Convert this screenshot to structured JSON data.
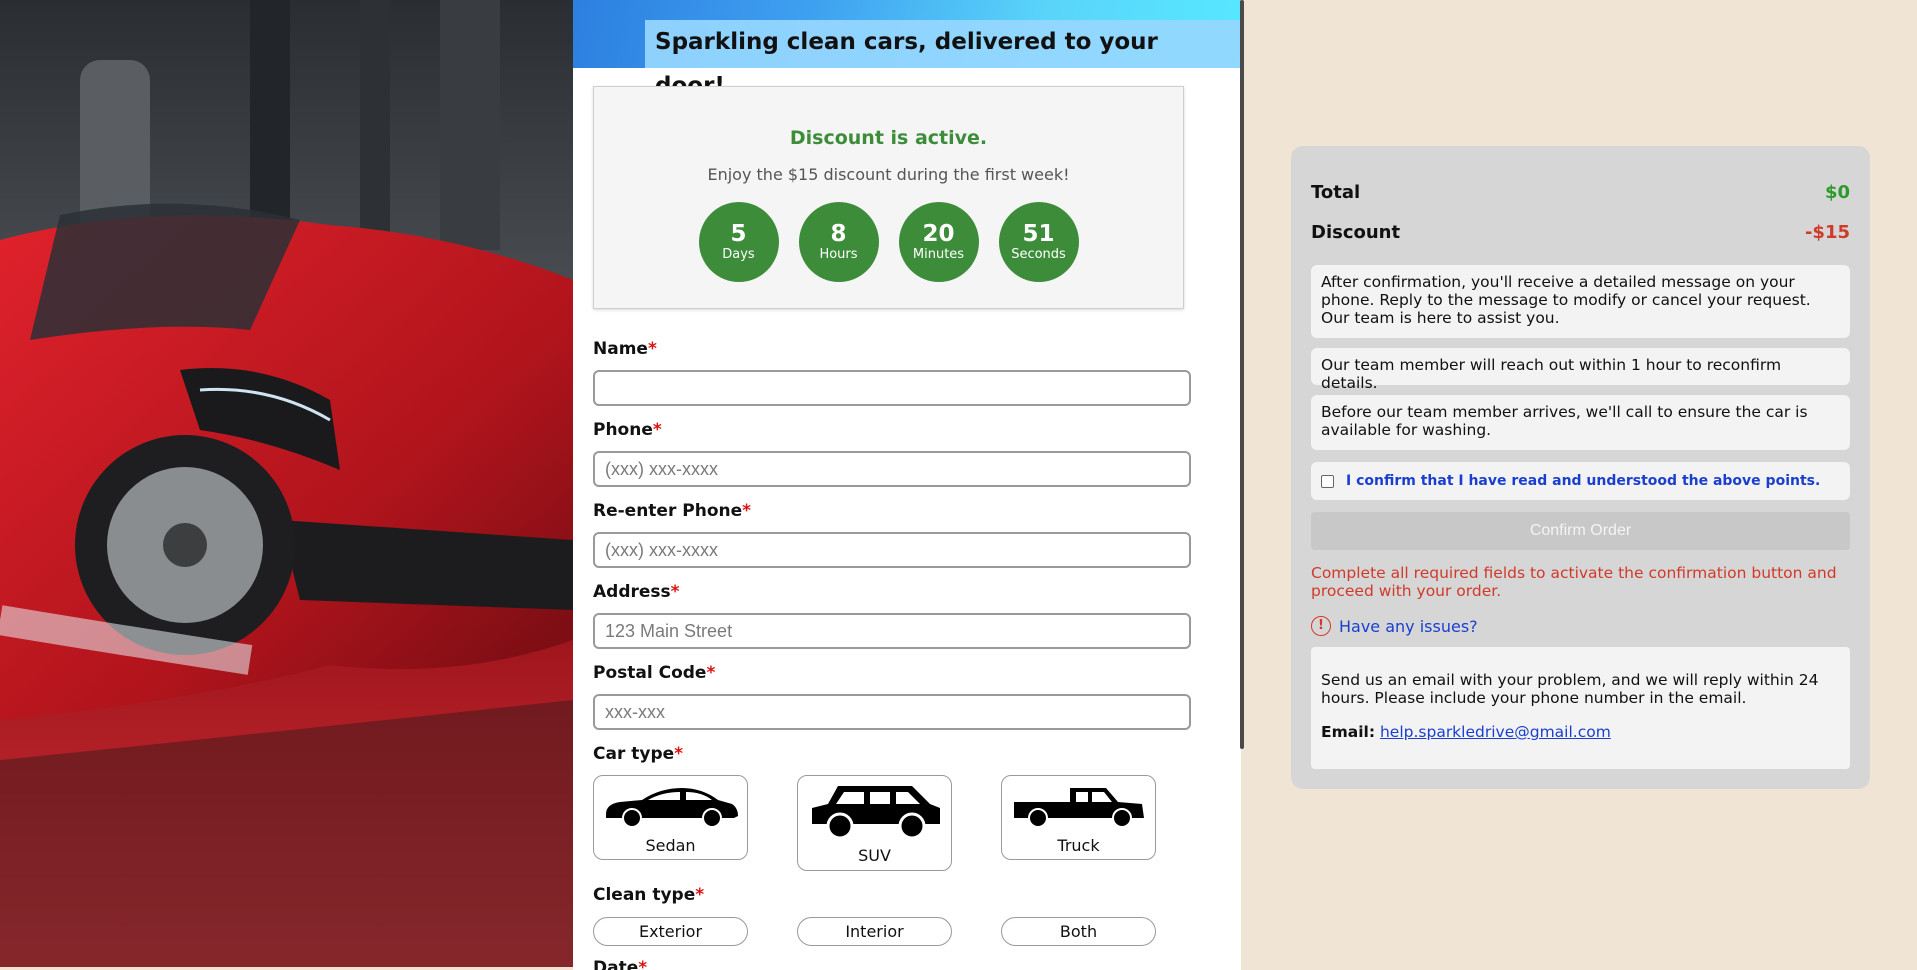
{
  "banner": {
    "title": "Sparkling clean cars, delivered to your door!"
  },
  "discount": {
    "title": "Discount is active.",
    "subtitle": "Enjoy the $15 discount during the first week!",
    "timer": [
      {
        "value": "5",
        "unit": "Days"
      },
      {
        "value": "8",
        "unit": "Hours"
      },
      {
        "value": "20",
        "unit": "Minutes"
      },
      {
        "value": "51",
        "unit": "Seconds"
      }
    ]
  },
  "form": {
    "required_mark": "*",
    "name": {
      "label": "Name",
      "placeholder": ""
    },
    "phone": {
      "label": "Phone",
      "placeholder": "(xxx) xxx-xxxx"
    },
    "phone_confirm": {
      "label": "Re-enter Phone",
      "placeholder": "(xxx) xxx-xxxx"
    },
    "address": {
      "label": "Address",
      "placeholder": "123 Main Street"
    },
    "postal": {
      "label": "Postal Code",
      "placeholder": "xxx-xxx"
    },
    "car_type": {
      "label": "Car type",
      "options": [
        "Sedan",
        "SUV",
        "Truck"
      ]
    },
    "clean_type": {
      "label": "Clean type",
      "options": [
        "Exterior",
        "Interior",
        "Both"
      ]
    },
    "date": {
      "label": "Date"
    }
  },
  "summary": {
    "total_label": "Total",
    "total_value": "$0",
    "discount_label": "Discount",
    "discount_value": "-$15",
    "notes": [
      "After confirmation, you'll receive a detailed message on your phone. Reply to the message to modify or cancel your request. Our team is here to assist you.",
      "Our team member will reach out within 1 hour to reconfirm details.",
      "Before our team member arrives, we'll call to ensure the car is available for washing."
    ],
    "confirm_checkbox": "I confirm that I have read and understood the above points.",
    "confirm_button": "Confirm Order",
    "warning": "Complete all required fields to activate the confirmation button and proceed with your order.",
    "issues_link": "Have any issues?",
    "help_text": "Send us an email with your problem, and we will reply within 24 hours. Please include your phone number in the email.",
    "email_label": "Email:",
    "email": "help.sparkledrive@gmail.com"
  },
  "colors": {
    "accent_green": "#3c8c3a",
    "price_green": "#2e9a2e",
    "alert_red": "#d03a2a",
    "link_blue": "#1a3fd0",
    "page_bg": "#f0e4d4"
  },
  "icons": [
    "sedan-icon",
    "suv-icon",
    "truck-icon",
    "alert-circle-icon"
  ]
}
